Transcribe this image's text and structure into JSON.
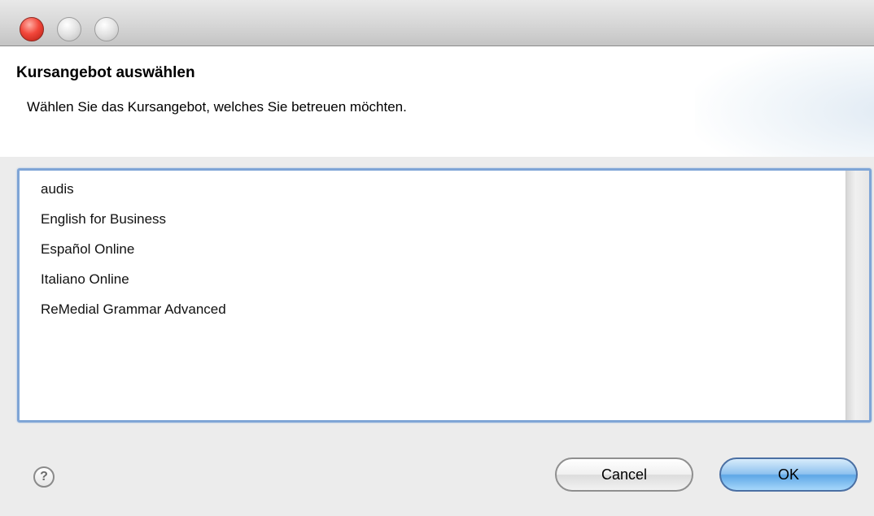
{
  "window": {
    "controls": [
      "close",
      "minimize",
      "zoom"
    ]
  },
  "header": {
    "title": "Kursangebot auswählen",
    "description": "Wählen Sie das Kursangebot, welches Sie betreuen möchten."
  },
  "course_list": {
    "items": [
      {
        "label": "audis"
      },
      {
        "label": "English for Business"
      },
      {
        "label": "Español Online"
      },
      {
        "label": "Italiano Online"
      },
      {
        "label": "ReMedial Grammar Advanced"
      }
    ]
  },
  "footer": {
    "help_symbol": "?",
    "cancel_label": "Cancel",
    "ok_label": "OK"
  },
  "colors": {
    "accent": "#7fa5d6",
    "default_button": "#5ea7e6",
    "close_button": "#f2473b"
  },
  "icons": {
    "help": "question-circle-icon"
  }
}
